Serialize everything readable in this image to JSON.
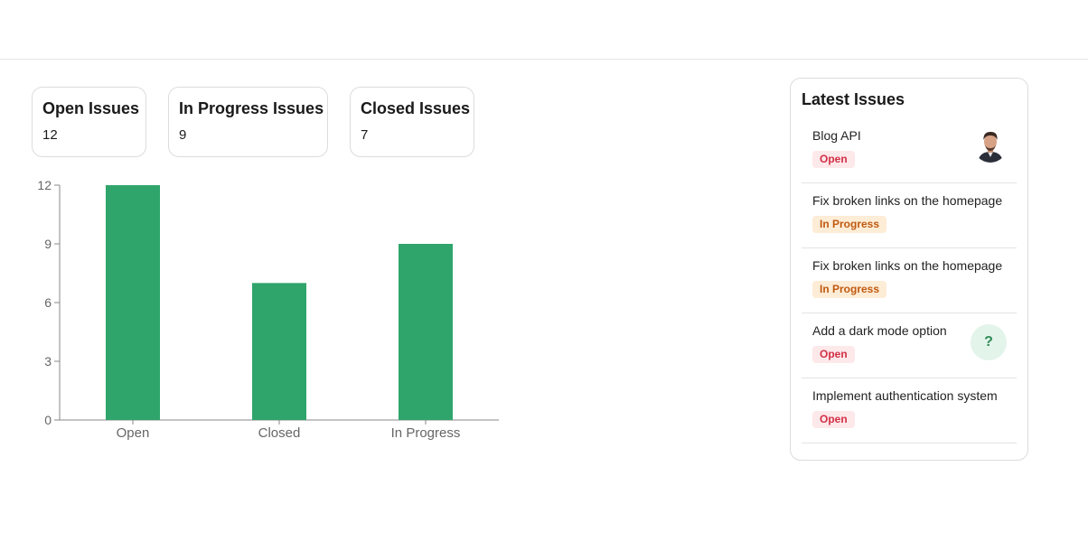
{
  "stats": [
    {
      "title": "Open Issues",
      "value": "12"
    },
    {
      "title": "In Progress Issues",
      "value": "9"
    },
    {
      "title": "Closed Issues",
      "value": "7"
    }
  ],
  "chart_data": {
    "type": "bar",
    "categories": [
      "Open",
      "Closed",
      "In Progress"
    ],
    "values": [
      12,
      7,
      9
    ],
    "ylim": [
      0,
      12
    ],
    "yticks": [
      0,
      3,
      6,
      9,
      12
    ],
    "title": "",
    "xlabel": "",
    "ylabel": "",
    "bar_color": "#2fa56c",
    "grid": false
  },
  "latest": {
    "title": "Latest Issues",
    "items": [
      {
        "title": "Blog API",
        "status": "Open",
        "avatar": "photo"
      },
      {
        "title": "Fix broken links on the homepage",
        "status": "In Progress",
        "avatar": "none"
      },
      {
        "title": "Fix broken links on the homepage",
        "status": "In Progress",
        "avatar": "none"
      },
      {
        "title": "Add a dark mode option",
        "status": "Open",
        "avatar": "?"
      },
      {
        "title": "Implement authentication system",
        "status": "Open",
        "avatar": "none"
      }
    ]
  },
  "colors": {
    "open_badge_bg": "#fde8ea",
    "open_badge_text": "#d12f45",
    "progress_badge_bg": "#fdecd6",
    "progress_badge_text": "#c05a10",
    "bar": "#2fa56c"
  }
}
